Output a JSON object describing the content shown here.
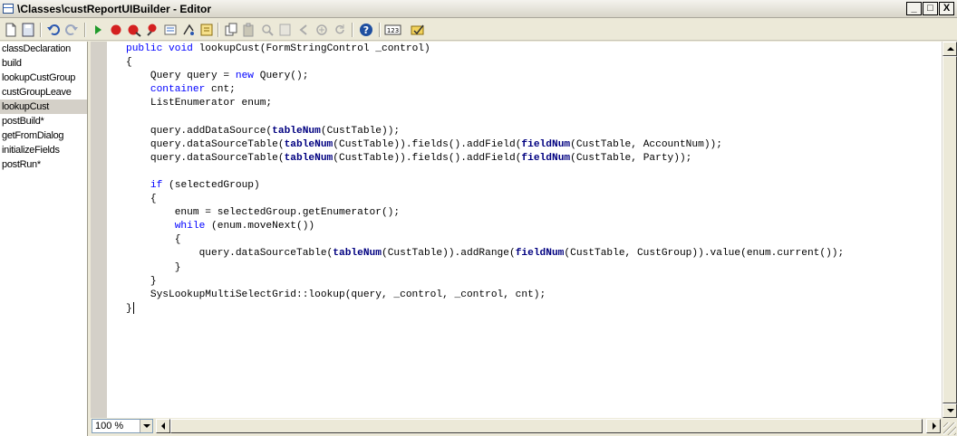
{
  "window": {
    "title": "\\Classes\\custReportUIBuilder - Editor",
    "buttons": {
      "minimize": "_",
      "maximize": "□",
      "close": "X"
    }
  },
  "toolbar": {
    "icons": [
      "new-icon",
      "save-icon",
      "undo-icon",
      "redo-icon",
      "run-icon",
      "breakpoint-icon",
      "remove-breakpoints-icon",
      "toggle-breakpoint-icon",
      "compile-icon",
      "lookup-icon",
      "script-icon",
      "copy-icon",
      "paste-icon",
      "find-icon",
      "replace-icon",
      "back-icon",
      "forward-icon",
      "reload-icon",
      "help-icon",
      "line-number-icon",
      "best-practice-icon"
    ],
    "line_number_label": "123"
  },
  "methods": {
    "selected": "lookupCust",
    "items": [
      "classDeclaration",
      "build",
      "lookupCustGroup",
      "custGroupLeave",
      "lookupCust",
      "postBuild*",
      "getFromDialog",
      "initializeFields",
      "postRun*"
    ]
  },
  "code": {
    "lines": [
      [
        [
          "kw",
          "public"
        ],
        [
          "t",
          " "
        ],
        [
          "kw",
          "void"
        ],
        [
          "t",
          " lookupCust(FormStringControl _control)"
        ]
      ],
      [
        [
          "t",
          "{"
        ]
      ],
      [
        [
          "t",
          "    Query query = "
        ],
        [
          "kw",
          "new"
        ],
        [
          "t",
          " Query();"
        ]
      ],
      [
        [
          "t",
          "    "
        ],
        [
          "kw",
          "container"
        ],
        [
          "t",
          " cnt;"
        ]
      ],
      [
        [
          "t",
          "    ListEnumerator enum;"
        ]
      ],
      [
        [
          "t",
          ""
        ]
      ],
      [
        [
          "t",
          "    query.addDataSource("
        ],
        [
          "fn",
          "tableNum"
        ],
        [
          "t",
          "(CustTable));"
        ]
      ],
      [
        [
          "t",
          "    query.dataSourceTable("
        ],
        [
          "fn",
          "tableNum"
        ],
        [
          "t",
          "(CustTable)).fields().addField("
        ],
        [
          "fn",
          "fieldNum"
        ],
        [
          "t",
          "(CustTable, AccountNum));"
        ]
      ],
      [
        [
          "t",
          "    query.dataSourceTable("
        ],
        [
          "fn",
          "tableNum"
        ],
        [
          "t",
          "(CustTable)).fields().addField("
        ],
        [
          "fn",
          "fieldNum"
        ],
        [
          "t",
          "(CustTable, Party));"
        ]
      ],
      [
        [
          "t",
          ""
        ]
      ],
      [
        [
          "t",
          "    "
        ],
        [
          "kw",
          "if"
        ],
        [
          "t",
          " (selectedGroup)"
        ]
      ],
      [
        [
          "t",
          "    {"
        ]
      ],
      [
        [
          "t",
          "        enum = selectedGroup.getEnumerator();"
        ]
      ],
      [
        [
          "t",
          "        "
        ],
        [
          "kw",
          "while"
        ],
        [
          "t",
          " (enum.moveNext())"
        ]
      ],
      [
        [
          "t",
          "        {"
        ]
      ],
      [
        [
          "t",
          "            query.dataSourceTable("
        ],
        [
          "fn",
          "tableNum"
        ],
        [
          "t",
          "(CustTable)).addRange("
        ],
        [
          "fn",
          "fieldNum"
        ],
        [
          "t",
          "(CustTable, CustGroup)).value(enum.current());"
        ]
      ],
      [
        [
          "t",
          "        }"
        ]
      ],
      [
        [
          "t",
          "    }"
        ]
      ],
      [
        [
          "t",
          "    SysLookupMultiSelectGrid::lookup(query, _control, _control, cnt);"
        ]
      ],
      [
        [
          "t",
          "}"
        ]
      ]
    ]
  },
  "statusbar": {
    "zoom": "100 %"
  }
}
